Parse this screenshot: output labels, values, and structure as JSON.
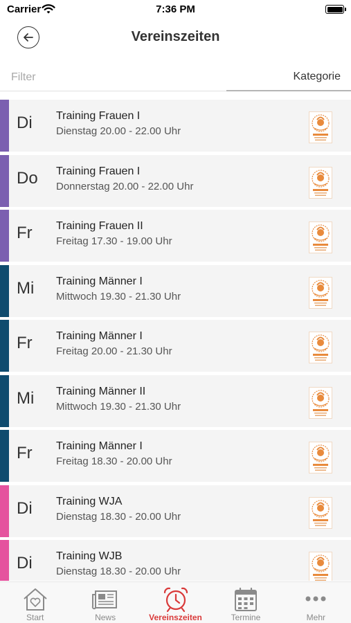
{
  "status_bar": {
    "carrier": "Carrier",
    "time": "7:36 PM"
  },
  "header": {
    "title": "Vereinszeiten"
  },
  "filter": {
    "placeholder": "Filter",
    "category_label": "Kategorie"
  },
  "colors": {
    "purple": "#7b5fb0",
    "dark_blue": "#0f4b6e",
    "pink": "#e5539e",
    "active_tab": "#d93a3a",
    "inactive_tab": "#8a8a8a",
    "logo_orange": "#e88a3c"
  },
  "entries": [
    {
      "day": "Di",
      "title": "Training Frauen I",
      "subtitle": "Dienstag 20.00 - 22.00 Uhr",
      "color": "#7b5fb0"
    },
    {
      "day": "Do",
      "title": "Training Frauen I",
      "subtitle": "Donnerstag 20.00 - 22.00 Uhr",
      "color": "#7b5fb0"
    },
    {
      "day": "Fr",
      "title": "Training Frauen II",
      "subtitle": "Freitag 17.30 - 19.00 Uhr",
      "color": "#7b5fb0"
    },
    {
      "day": "Mi",
      "title": "Training Männer I",
      "subtitle": "Mittwoch 19.30 - 21.30 Uhr",
      "color": "#0f4b6e"
    },
    {
      "day": "Fr",
      "title": "Training Männer I",
      "subtitle": "Freitag 20.00 - 21.30 Uhr",
      "color": "#0f4b6e"
    },
    {
      "day": "Mi",
      "title": "Training Männer II",
      "subtitle": "Mittwoch 19.30 - 21.30 Uhr",
      "color": "#0f4b6e"
    },
    {
      "day": "Fr",
      "title": "Training Männer I",
      "subtitle": "Freitag 18.30 - 20.00 Uhr",
      "color": "#0f4b6e"
    },
    {
      "day": "Di",
      "title": "Training WJA",
      "subtitle": "Dienstag 18.30 - 20.00 Uhr",
      "color": "#e5539e"
    },
    {
      "day": "Di",
      "title": "Training WJB",
      "subtitle": "Dienstag 18.30 - 20.00 Uhr",
      "color": "#e5539e"
    }
  ],
  "tabs": [
    {
      "label": "Start",
      "icon": "house-heart-icon",
      "active": false
    },
    {
      "label": "News",
      "icon": "newspaper-icon",
      "active": false
    },
    {
      "label": "Vereinszeiten",
      "icon": "alarm-clock-icon",
      "active": true
    },
    {
      "label": "Termine",
      "icon": "calendar-icon",
      "active": false
    },
    {
      "label": "Mehr",
      "icon": "more-dots-icon",
      "active": false
    }
  ]
}
